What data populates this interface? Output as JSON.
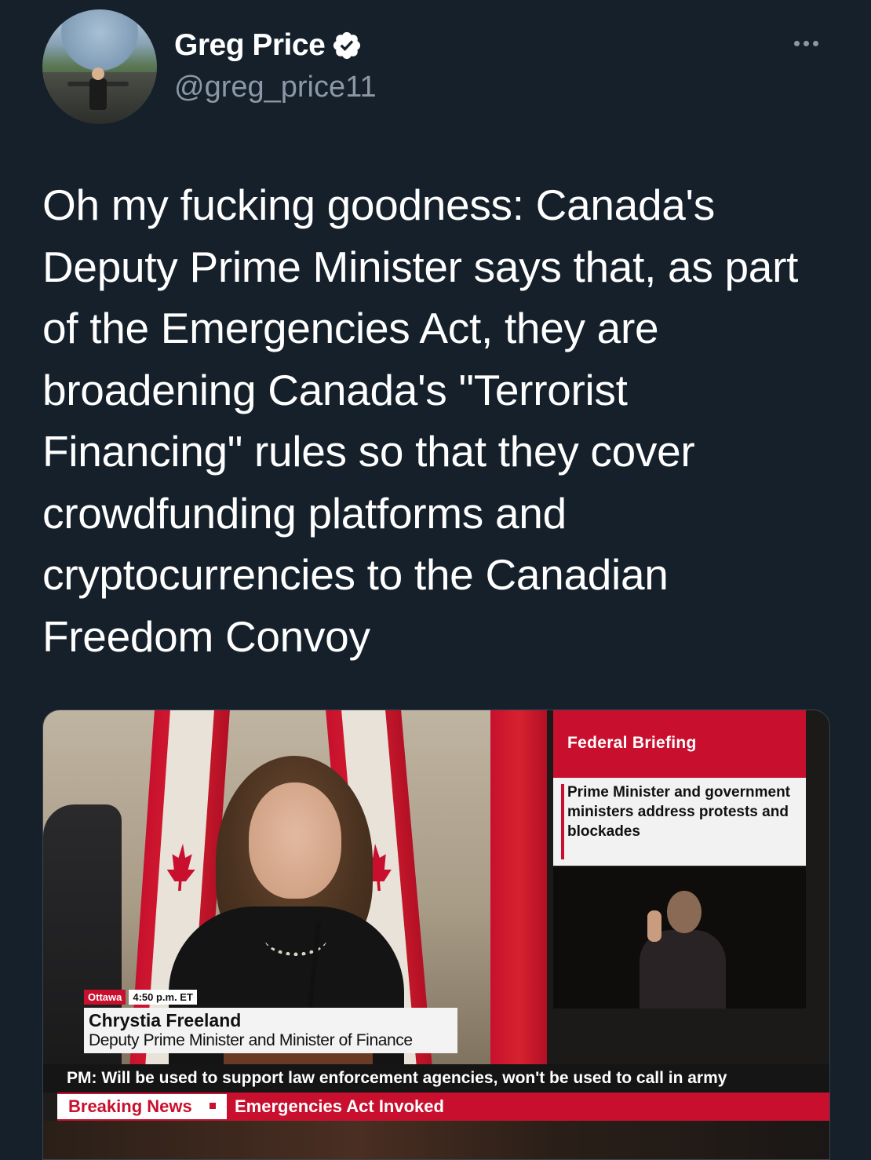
{
  "author": {
    "name": "Greg Price",
    "handle": "@greg_price11",
    "verified": true
  },
  "tweet": {
    "text": "Oh my fucking goodness: Canada's Deputy Prime Minister says that, as part of the Emergencies Act, they are broadening Canada's \"Terrorist Financing\" rules so that they cover crowdfunding platforms and cryptocurrencies to the Canadian Freedom Convoy"
  },
  "media": {
    "lower_third": {
      "location": "Ottawa",
      "time": "4:50 p.m. ET",
      "name": "Chrystia Freeland",
      "title": "Deputy Prime Minister and Minister of Finance"
    },
    "sidebar": {
      "header": "Federal Briefing",
      "description": "Prime Minister and government ministers address protests and blockades"
    },
    "ticker": "PM: Will be used to support law enforcement agencies, won't be used to call in army",
    "breaking": {
      "label": "Breaking News",
      "headline": "Emergencies Act Invoked"
    }
  },
  "colors": {
    "background": "#15202b",
    "secondary_text": "#8b98a5",
    "verified_badge": "#ffffff",
    "cbc_red": "#c8102e"
  },
  "icons": {
    "verified": "verified-badge-icon",
    "more": "more-options-icon"
  }
}
